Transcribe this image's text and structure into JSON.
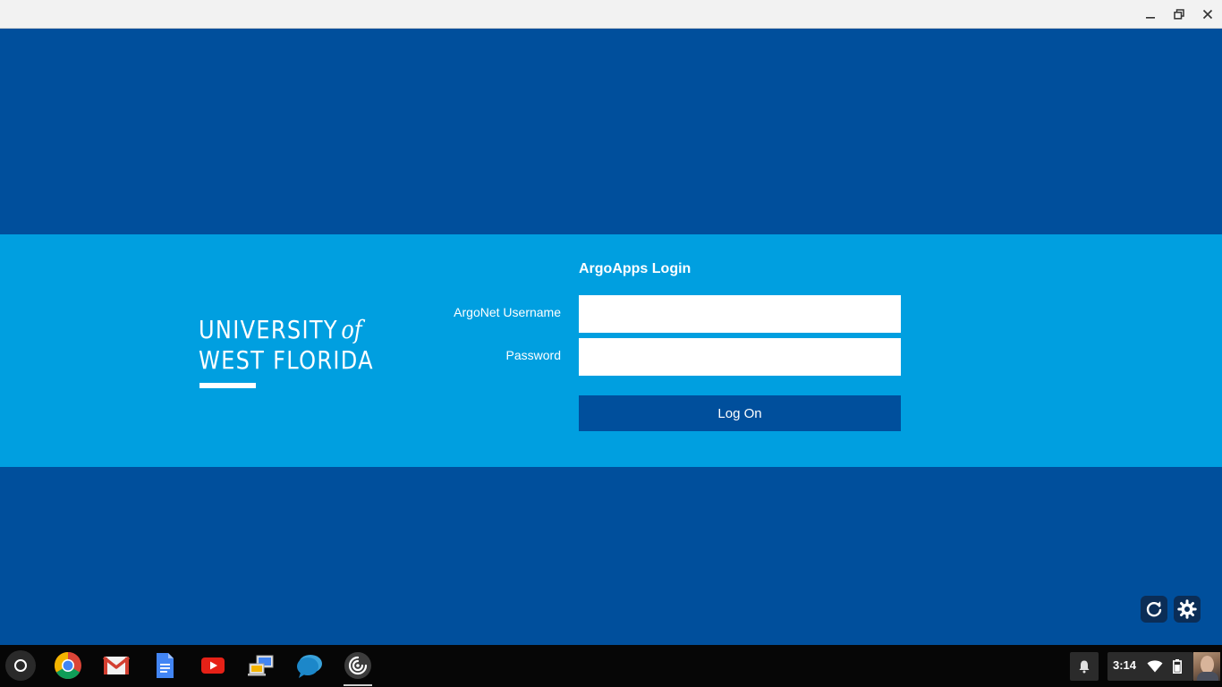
{
  "window": {
    "controls": {
      "minimize_icon": "minimize-icon",
      "maximize_icon": "restore-icon",
      "close_icon": "close-icon"
    }
  },
  "login": {
    "title": "ArgoApps Login",
    "username_label": "ArgoNet Username",
    "username_value": "",
    "password_label": "Password",
    "password_value": "",
    "submit_label": "Log On"
  },
  "logo": {
    "line1": "UNIVERSITY",
    "line1_of": "of",
    "line2": "WEST FLORIDA"
  },
  "corner_buttons": [
    {
      "icon": "refresh-icon"
    },
    {
      "icon": "gear-icon"
    }
  ],
  "shelf": {
    "apps": [
      "chrome",
      "gmail",
      "docs",
      "youtube",
      "remote-desktop",
      "hangouts",
      "citrix-receiver"
    ],
    "active_app": "citrix-receiver",
    "clock": "3:14"
  },
  "colors": {
    "page_background": "#004f9c",
    "login_band": "#009fe0",
    "button": "#004f9c",
    "titlebar": "#f2f2f2"
  }
}
